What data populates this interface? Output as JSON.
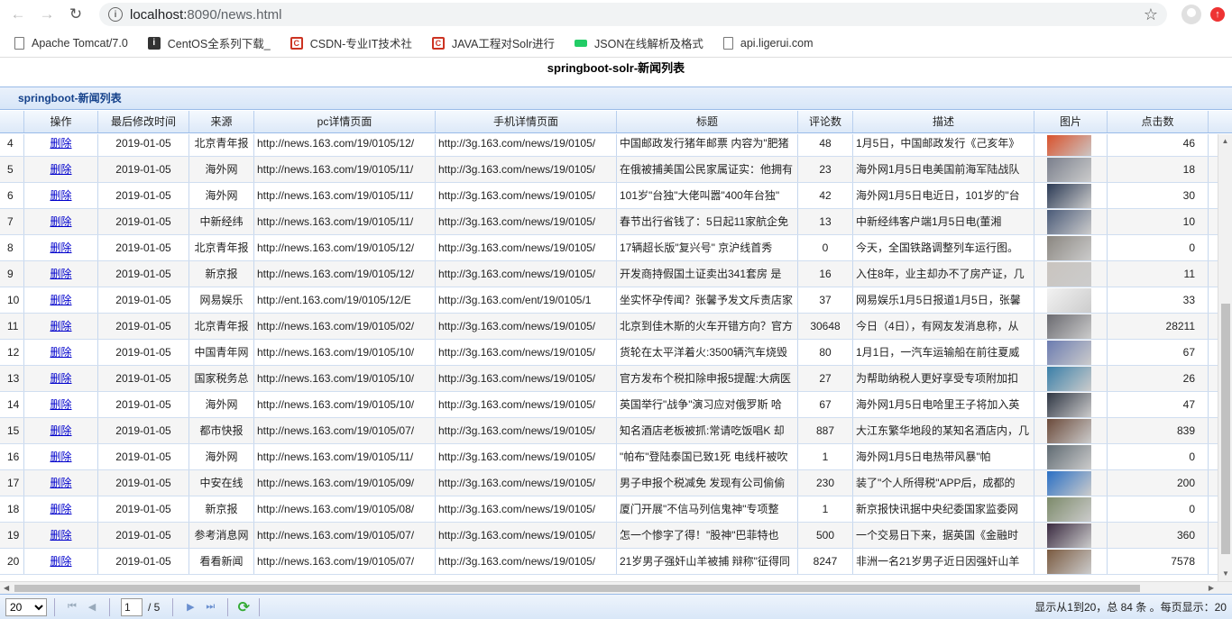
{
  "browser": {
    "url_host": "localhost:",
    "url_path": "8090/news.html",
    "bookmarks": [
      {
        "label": "Apache Tomcat/7.0",
        "icon": "doc-icon"
      },
      {
        "label": "CentOS全系列下载_",
        "icon": "centos-icon"
      },
      {
        "label": "CSDN-专业IT技术社",
        "icon": "csdn-icon"
      },
      {
        "label": "JAVA工程对Solr进行",
        "icon": "csdn-icon"
      },
      {
        "label": "JSON在线解析及格式",
        "icon": "json-icon"
      },
      {
        "label": "api.ligerui.com",
        "icon": "doc-icon"
      }
    ]
  },
  "page": {
    "title": "springboot-solr-新闻列表"
  },
  "grid": {
    "title": "springboot-新闻列表",
    "columns": [
      "操作",
      "最后修改时间",
      "来源",
      "pc详情页面",
      "手机详情页面",
      "标题",
      "评论数",
      "描述",
      "图片",
      "点击数"
    ],
    "delete_label": "删除",
    "rows": [
      {
        "n": "4",
        "date": "2019-01-05",
        "src": "北京青年报",
        "pc": "http://news.163.com/19/0105/12/",
        "m": "http://3g.163.com/news/19/0105/",
        "title": "中国邮政发行猪年邮票 内容为\"肥猪",
        "comments": "48",
        "desc": "1月5日，中国邮政发行《己亥年》",
        "clicks": "46",
        "color": "#d9522c"
      },
      {
        "n": "5",
        "date": "2019-01-05",
        "src": "海外网",
        "pc": "http://news.163.com/19/0105/11/",
        "m": "http://3g.163.com/news/19/0105/",
        "title": "在俄被捕美国公民家属证实：他拥有",
        "comments": "23",
        "desc": "海外网1月5日电美国前海军陆战队",
        "clicks": "18",
        "color": "#7a7f8c"
      },
      {
        "n": "6",
        "date": "2019-01-05",
        "src": "海外网",
        "pc": "http://news.163.com/19/0105/11/",
        "m": "http://3g.163.com/news/19/0105/",
        "title": "101岁\"台独\"大佬叫嚣\"400年台独\"",
        "comments": "42",
        "desc": "海外网1月5日电近日，101岁的\"台",
        "clicks": "30",
        "color": "#2b3a55"
      },
      {
        "n": "7",
        "date": "2019-01-05",
        "src": "中新经纬",
        "pc": "http://news.163.com/19/0105/11/",
        "m": "http://3g.163.com/news/19/0105/",
        "title": "春节出行省钱了：5日起11家航企免",
        "comments": "13",
        "desc": "中新经纬客户端1月5日电(董湘",
        "clicks": "10",
        "color": "#4a5a78"
      },
      {
        "n": "8",
        "date": "2019-01-05",
        "src": "北京青年报",
        "pc": "http://news.163.com/19/0105/12/",
        "m": "http://3g.163.com/news/19/0105/",
        "title": "17辆超长版\"复兴号\" 京沪线首秀",
        "comments": "0",
        "desc": "今天，全国铁路调整列车运行图。",
        "clicks": "0",
        "color": "#8a8680"
      },
      {
        "n": "9",
        "date": "2019-01-05",
        "src": "新京报",
        "pc": "http://news.163.com/19/0105/12/",
        "m": "http://3g.163.com/news/19/0105/",
        "title": "开发商持假国土证卖出341套房 是",
        "comments": "16",
        "desc": "入住8年，业主却办不了房产证，几",
        "clicks": "11",
        "color": "#c9c4bf"
      },
      {
        "n": "10",
        "date": "2019-01-05",
        "src": "网易娱乐",
        "pc": "http://ent.163.com/19/0105/12/E",
        "m": "http://3g.163.com/ent/19/0105/1",
        "title": "坐实怀孕传闻？张馨予发文斥责店家",
        "comments": "37",
        "desc": "网易娱乐1月5日报道1月5日，张馨",
        "clicks": "33",
        "color": "#f2f2f2"
      },
      {
        "n": "11",
        "date": "2019-01-05",
        "src": "北京青年报",
        "pc": "http://news.163.com/19/0105/02/",
        "m": "http://3g.163.com/news/19/0105/",
        "title": "北京到佳木斯的火车开错方向？官方",
        "comments": "30648",
        "desc": "今日（4日），有网友发消息称，从",
        "clicks": "28211",
        "color": "#6a6a70"
      },
      {
        "n": "12",
        "date": "2019-01-05",
        "src": "中国青年网",
        "pc": "http://news.163.com/19/0105/10/",
        "m": "http://3g.163.com/news/19/0105/",
        "title": "货轮在太平洋着火:3500辆汽车烧毁",
        "comments": "80",
        "desc": "1月1日，一汽车运输船在前往夏威",
        "clicks": "67",
        "color": "#6b7bb0"
      },
      {
        "n": "13",
        "date": "2019-01-05",
        "src": "国家税务总",
        "pc": "http://news.163.com/19/0105/10/",
        "m": "http://3g.163.com/news/19/0105/",
        "title": "官方发布个税扣除申报5提醒:大病医",
        "comments": "27",
        "desc": "为帮助纳税人更好享受专项附加扣",
        "clicks": "26",
        "color": "#3a7fa8"
      },
      {
        "n": "14",
        "date": "2019-01-05",
        "src": "海外网",
        "pc": "http://news.163.com/19/0105/10/",
        "m": "http://3g.163.com/news/19/0105/",
        "title": "英国举行\"战争\"演习应对俄罗斯 哈",
        "comments": "67",
        "desc": "海外网1月5日电哈里王子将加入英",
        "clicks": "47",
        "color": "#2f3644"
      },
      {
        "n": "15",
        "date": "2019-01-05",
        "src": "都市快报",
        "pc": "http://news.163.com/19/0105/07/",
        "m": "http://3g.163.com/news/19/0105/",
        "title": "知名酒店老板被抓:常请吃饭唱K 却",
        "comments": "887",
        "desc": "大江东繁华地段的某知名酒店内，几",
        "clicks": "839",
        "color": "#6b4a3a"
      },
      {
        "n": "16",
        "date": "2019-01-05",
        "src": "海外网",
        "pc": "http://news.163.com/19/0105/11/",
        "m": "http://3g.163.com/news/19/0105/",
        "title": "\"帕布\"登陆泰国已致1死 电线杆被吹",
        "comments": "1",
        "desc": "海外网1月5日电热带风暴\"帕",
        "clicks": "0",
        "color": "#5f6a72"
      },
      {
        "n": "17",
        "date": "2019-01-05",
        "src": "中安在线",
        "pc": "http://news.163.com/19/0105/09/",
        "m": "http://3g.163.com/news/19/0105/",
        "title": "男子申报个税减免 发现有公司偷偷",
        "comments": "230",
        "desc": "装了\"个人所得税\"APP后，成都的",
        "clicks": "200",
        "color": "#2a6fc4"
      },
      {
        "n": "18",
        "date": "2019-01-05",
        "src": "新京报",
        "pc": "http://news.163.com/19/0105/08/",
        "m": "http://3g.163.com/news/19/0105/",
        "title": "厦门开展\"不信马列信鬼神\"专项整",
        "comments": "1",
        "desc": "新京报快讯据中央纪委国家监委网",
        "clicks": "0",
        "color": "#7c8a6a"
      },
      {
        "n": "19",
        "date": "2019-01-05",
        "src": "参考消息网",
        "pc": "http://news.163.com/19/0105/07/",
        "m": "http://3g.163.com/news/19/0105/",
        "title": "怎一个惨字了得！\"股神\"巴菲特也",
        "comments": "500",
        "desc": "一个交易日下来，据英国《金融时",
        "clicks": "360",
        "color": "#3a2a40"
      },
      {
        "n": "20",
        "date": "2019-01-05",
        "src": "看看新闻",
        "pc": "http://news.163.com/19/0105/07/",
        "m": "http://3g.163.com/news/19/0105/",
        "title": "21岁男子强奸山羊被捕 辩称\"征得同",
        "comments": "8247",
        "desc": "非洲一名21岁男子近日因强奸山羊",
        "clicks": "7578",
        "color": "#7a5a40"
      }
    ]
  },
  "pager": {
    "page_size": "20",
    "current_page": "1",
    "total_pages": "/ 5",
    "info": "显示从1到20，总 84 条 。每页显示：20"
  }
}
